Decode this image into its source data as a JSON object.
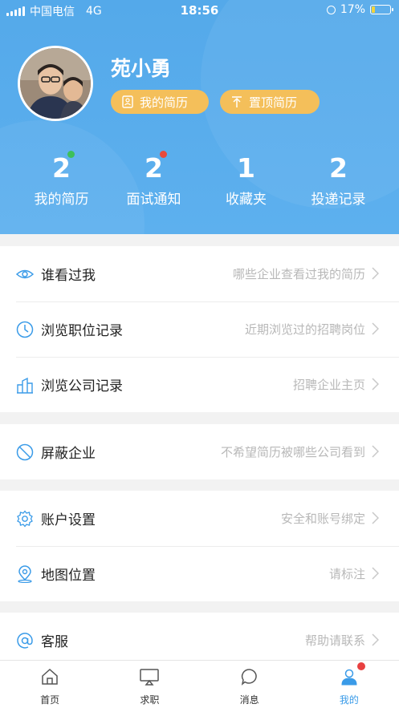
{
  "status_bar": {
    "carrier": "中国电信",
    "network": "4G",
    "time": "18:56",
    "battery": "17%"
  },
  "profile": {
    "name": "苑小勇",
    "resume_button": "我的简历",
    "pin_button": "置顶简历"
  },
  "stats": [
    {
      "value": "2",
      "label": "我的简历",
      "dot_color": "#3dc05a"
    },
    {
      "value": "2",
      "label": "面试通知",
      "dot_color": "#e84a3c"
    },
    {
      "value": "1",
      "label": "收藏夹"
    },
    {
      "value": "2",
      "label": "投递记录"
    }
  ],
  "menu": {
    "viewed_me": {
      "title": "谁看过我",
      "hint": "哪些企业查看过我的简历",
      "icon": "eye-icon"
    },
    "job_history": {
      "title": "浏览职位记录",
      "hint": "近期浏览过的招聘岗位",
      "icon": "clock-icon"
    },
    "company_history": {
      "title": "浏览公司记录",
      "hint": "招聘企业主页",
      "icon": "building-icon"
    },
    "block_company": {
      "title": "屏蔽企业",
      "hint": "不希望简历被哪些公司看到",
      "icon": "block-icon"
    },
    "account_settings": {
      "title": "账户设置",
      "hint": "安全和账号绑定",
      "icon": "gear-icon"
    },
    "map_location": {
      "title": "地图位置",
      "hint": "请标注",
      "icon": "location-icon"
    },
    "customer_service": {
      "title": "客服",
      "hint": "帮助请联系",
      "icon": "at-icon"
    }
  },
  "tabbar": {
    "home": "首页",
    "jobs": "求职",
    "messages": "消息",
    "mine": "我的"
  },
  "colors": {
    "header": "#5aaeed",
    "accent": "#3a9be8",
    "pill": "#f4bf5a",
    "badge": "#e84040"
  }
}
